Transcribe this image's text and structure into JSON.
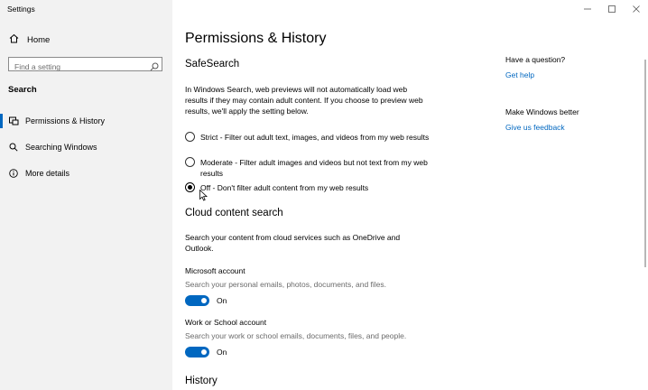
{
  "window": {
    "title": "Settings",
    "controls": [
      "minimize-icon",
      "maximize-icon",
      "close-icon"
    ]
  },
  "sidebar": {
    "home_label": "Home",
    "search_placeholder": "Find a setting",
    "section_title": "Search",
    "items": [
      {
        "label": "Permissions & History",
        "icon": "permissions-icon",
        "selected": true
      },
      {
        "label": "Searching Windows",
        "icon": "search-icon",
        "selected": false
      },
      {
        "label": "More details",
        "icon": "info-icon",
        "selected": false
      }
    ]
  },
  "main": {
    "title": "Permissions & History",
    "safesearch": {
      "heading": "SafeSearch",
      "description": "In Windows Search, web previews will not automatically load web results if they may contain adult content. If you choose to preview web results, we'll apply the setting below.",
      "options": [
        {
          "label": "Strict - Filter out adult text, images, and videos from my web results",
          "selected": false
        },
        {
          "label": "Moderate - Filter adult images and videos but not text from my web results",
          "selected": false
        },
        {
          "label": "Off - Don't filter adult content from my web results",
          "selected": true
        }
      ]
    },
    "cloud": {
      "heading": "Cloud content search",
      "description": "Search your content from cloud services such as OneDrive and Outlook.",
      "microsoft_account": {
        "label": "Microsoft account",
        "description": "Search your personal emails, photos, documents, and files.",
        "toggle_state": "On"
      },
      "work_account": {
        "label": "Work or School account",
        "description": "Search your work or school emails, documents, files, and people.",
        "toggle_state": "On"
      }
    },
    "history": {
      "heading": "History"
    }
  },
  "aside": {
    "question_heading": "Have a question?",
    "help_link": "Get help",
    "better_heading": "Make Windows better",
    "feedback_link": "Give us feedback"
  },
  "colors": {
    "accent": "#0067c0",
    "sidebar_bg": "#f2f2f2",
    "description_text": "#6b6b6b"
  }
}
